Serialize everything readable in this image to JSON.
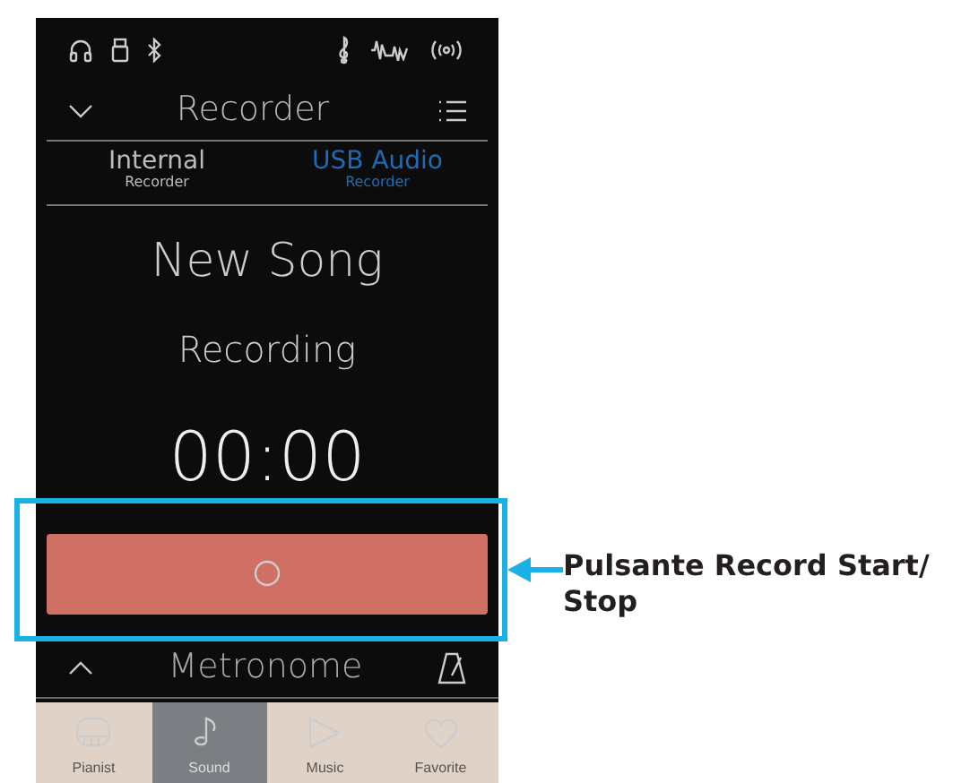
{
  "header": {
    "title": "Recorder"
  },
  "tabs": [
    {
      "label": "Internal",
      "sublabel": "Recorder",
      "selected": false
    },
    {
      "label": "USB Audio",
      "sublabel": "Recorder",
      "selected": true
    }
  ],
  "song": {
    "name": "New Song",
    "status": "Recording",
    "time": "00:00"
  },
  "metronome": {
    "label": "Metronome"
  },
  "nav": [
    {
      "kind": "piano",
      "label": "Pianist",
      "selected": false
    },
    {
      "kind": "note",
      "label": "Sound",
      "selected": true
    },
    {
      "kind": "play",
      "label": "Music",
      "selected": false
    },
    {
      "kind": "heart",
      "label": "Favorite",
      "selected": false
    }
  ],
  "callout": {
    "label": "Pulsante Record Start/ Stop"
  }
}
